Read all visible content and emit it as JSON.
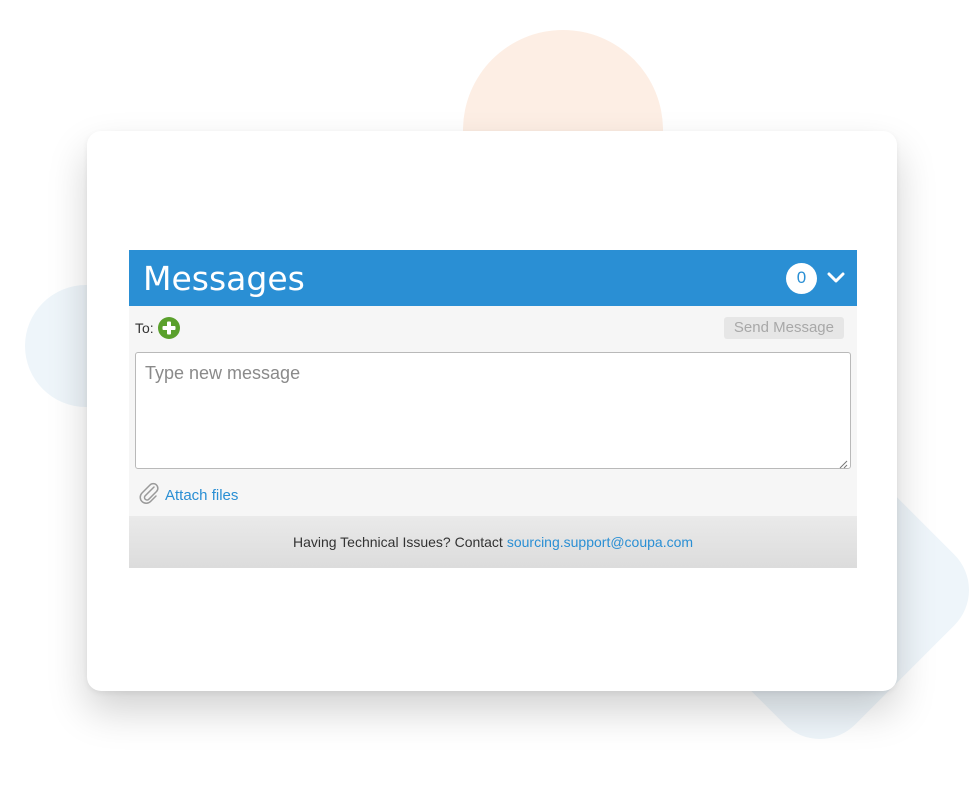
{
  "header": {
    "title": "Messages",
    "message_count": "0",
    "collapse_icon": "chevron-down-icon"
  },
  "compose": {
    "to_label": "To:",
    "add_recipient_icon": "plus-circle-icon",
    "send_label": "Send Message",
    "message_placeholder": "Type new message",
    "message_value": "",
    "attach_icon": "paperclip-icon",
    "attach_label": "Attach files"
  },
  "footer": {
    "text": "Having Technical Issues? Contact",
    "email": "sourcing.support@coupa.com"
  },
  "colors": {
    "header_bg": "#2a8fd4",
    "link": "#2a8fd4",
    "add_green": "#5aa02c"
  }
}
